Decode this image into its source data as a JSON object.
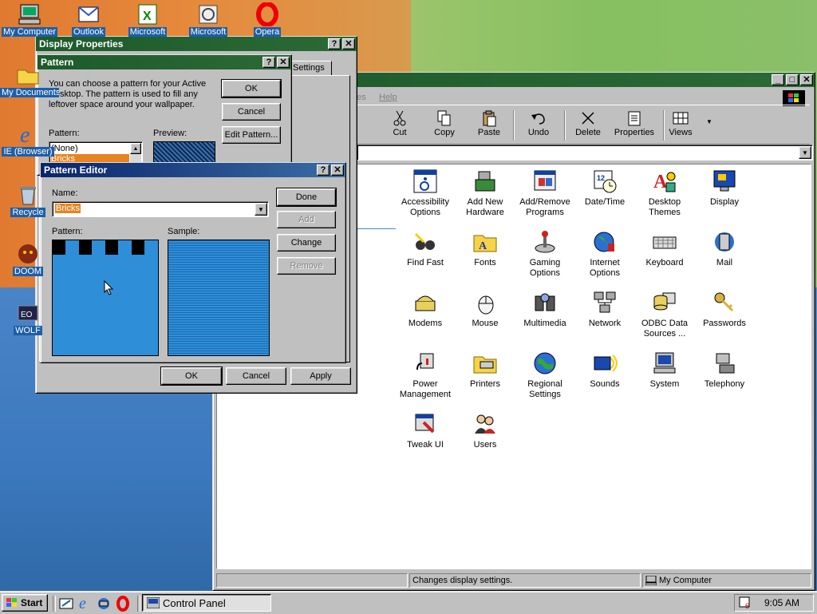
{
  "desktop_icons": [
    {
      "label": "My Computer",
      "icon": "computer-icon"
    },
    {
      "label": "Outlook",
      "icon": "outlook-icon"
    },
    {
      "label": "Microsoft",
      "icon": "excel-icon"
    },
    {
      "label": "Microsoft",
      "icon": "project-icon"
    },
    {
      "label": "Opera",
      "icon": "opera-icon"
    },
    {
      "label": "My Documents",
      "icon": "folder-icon"
    },
    {
      "label": "IE (Browser)",
      "icon": "ie-icon"
    },
    {
      "label": "Recycle",
      "icon": "recycle-icon"
    },
    {
      "label": "DOOM",
      "icon": "doom-icon"
    },
    {
      "label": "WOLF",
      "icon": "wolf-icon"
    }
  ],
  "control_panel": {
    "menu_items": [
      "es",
      "Help"
    ],
    "toolbar": [
      "Cut",
      "Copy",
      "Paste",
      "Undo",
      "Delete",
      "Properties",
      "Views"
    ],
    "items": [
      "Accessibility Options",
      "Add New Hardware",
      "Add/Remove Programs",
      "Date/Time",
      "Desktop Themes",
      "Display",
      "Find Fast",
      "Fonts",
      "Gaming Options",
      "Internet Options",
      "Keyboard",
      "Mail",
      "Modems",
      "Mouse",
      "Multimedia",
      "Network",
      "ODBC Data Sources ...",
      "Passwords",
      "Power Management",
      "Printers",
      "Regional Settings",
      "Sounds",
      "System",
      "Telephony",
      "Tweak UI",
      "Users"
    ],
    "status_text": "Changes display settings.",
    "status_location": "My Computer"
  },
  "display_properties": {
    "title": "Display Properties",
    "tab_settings": "Settings",
    "ok": "OK",
    "cancel": "Cancel",
    "apply": "Apply"
  },
  "pattern_dialog": {
    "title": "Pattern",
    "description": "You can choose a pattern for your Active Desktop.  The pattern is used to fill any leftover space around your wallpaper.",
    "pattern_label": "Pattern:",
    "preview_label": "Preview:",
    "list": [
      "(None)",
      "Bricks"
    ],
    "ok": "OK",
    "cancel": "Cancel",
    "edit": "Edit Pattern..."
  },
  "pattern_editor": {
    "title": "Pattern Editor",
    "name_label": "Name:",
    "name_value": "Bricks",
    "pattern_label": "Pattern:",
    "sample_label": "Sample:",
    "done": "Done",
    "add": "Add",
    "change": "Change",
    "remove": "Remove"
  },
  "taskbar": {
    "start": "Start",
    "task": "Control Panel",
    "clock": "9:05 AM"
  },
  "colors": {
    "selection": "#e8831e",
    "pattern_blue": "#2f8ed8",
    "title_green": "#1d5a2c"
  }
}
